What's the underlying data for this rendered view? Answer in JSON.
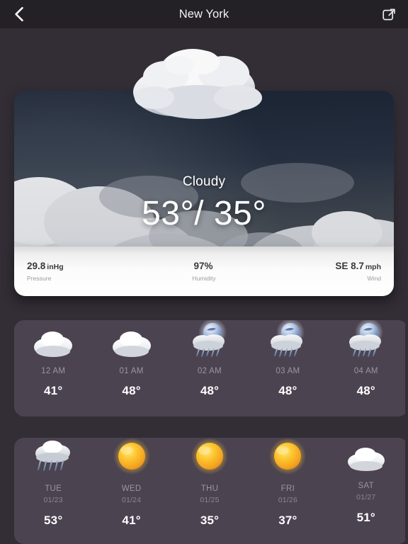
{
  "topbar": {
    "back_icon": "chevron-left-icon",
    "title": "New York",
    "share_icon": "share-square-icon"
  },
  "hero": {
    "condition": "Cloudy",
    "temperature": "53°/ 35°",
    "background_icon": "cloudy-photo"
  },
  "stats": [
    {
      "value": "29.8",
      "unit": "inHg",
      "label": "Pressure"
    },
    {
      "value": "97%",
      "unit": "",
      "label": "Humidity"
    },
    {
      "value": "SE 8.7",
      "unit": "mph",
      "label": "Wind"
    }
  ],
  "hourly": [
    {
      "time": "12 AM",
      "temp": "41°",
      "icon": "cloud-icon"
    },
    {
      "time": "01 AM",
      "temp": "48°",
      "icon": "cloud-icon"
    },
    {
      "time": "02 AM",
      "temp": "48°",
      "icon": "moon-rain-icon"
    },
    {
      "time": "03 AM",
      "temp": "48°",
      "icon": "moon-rain-icon"
    },
    {
      "time": "04 AM",
      "temp": "48°",
      "icon": "moon-rain-icon"
    }
  ],
  "daily": [
    {
      "day": "TUE",
      "date": "01/23",
      "temp": "53°",
      "icon": "rain-cloud-icon"
    },
    {
      "day": "WED",
      "date": "01/24",
      "temp": "41°",
      "icon": "sun-icon"
    },
    {
      "day": "THU",
      "date": "01/25",
      "temp": "35°",
      "icon": "sun-icon"
    },
    {
      "day": "FRI",
      "date": "01/26",
      "temp": "37°",
      "icon": "sun-icon"
    },
    {
      "day": "SAT",
      "date": "01/27",
      "temp": "51°",
      "icon": "cloud-icon"
    }
  ],
  "colors": {
    "page_bg": "#332e36",
    "topbar_bg": "#232026",
    "card_bg": "#4c4351",
    "accent_sun": "#f7b733",
    "text_primary": "#ffffff",
    "text_muted": "#9c94a2"
  }
}
